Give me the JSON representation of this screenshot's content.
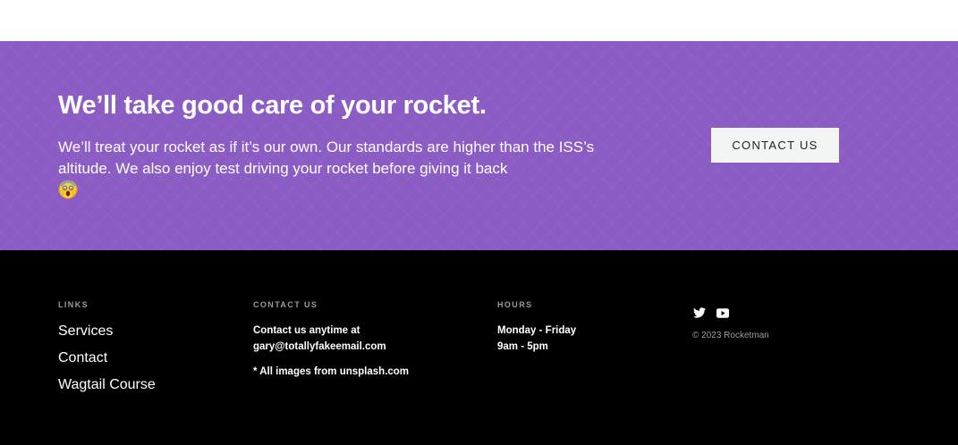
{
  "cta": {
    "title": "We’ll take good care of your rocket.",
    "text": "We’ll treat your rocket as if it’s our own. Our standards are higher than the ISS’s altitude. We also enjoy test driving your rocket before giving it back",
    "emoji": "screaming-face-emoji",
    "button_label": "CONTACT US",
    "background_color": "#8a5cc4"
  },
  "footer": {
    "links": {
      "heading": "LINKS",
      "items": [
        {
          "label": "Services"
        },
        {
          "label": "Contact"
        },
        {
          "label": "Wagtail Course"
        }
      ]
    },
    "contact": {
      "heading": "CONTACT US",
      "line1": "Contact us anytime at",
      "email": "gary@totallyfakeemail.com",
      "note": "* All images from unsplash.com"
    },
    "hours": {
      "heading": "HOURS",
      "days": "Monday - Friday",
      "time": "9am - 5pm"
    },
    "social": {
      "icons": [
        "twitter-icon",
        "youtube-icon"
      ]
    },
    "copyright": "© 2023 Rocketman"
  }
}
